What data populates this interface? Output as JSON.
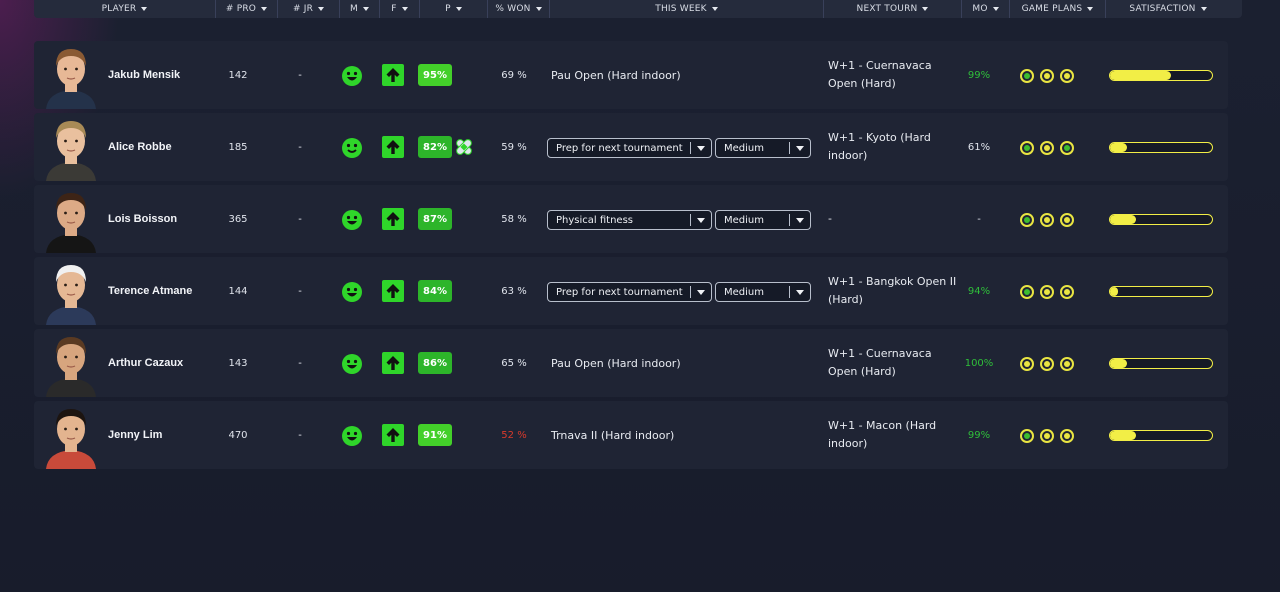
{
  "header": {
    "columns": [
      {
        "label": "PLAYER",
        "width": 182
      },
      {
        "label": "# PRO",
        "width": 62
      },
      {
        "label": "# JR",
        "width": 62
      },
      {
        "label": "M",
        "width": 40
      },
      {
        "label": "F",
        "width": 40
      },
      {
        "label": "P",
        "width": 68
      },
      {
        "label": "% WON",
        "width": 62
      },
      {
        "label": "THIS WEEK",
        "width": 274
      },
      {
        "label": "NEXT TOURN",
        "width": 138
      },
      {
        "label": "MO",
        "width": 48
      },
      {
        "label": "GAME PLANS",
        "width": 96
      },
      {
        "label": "SATISFACTION",
        "width": 124
      }
    ]
  },
  "players": [
    {
      "name": "Jakub Mensik",
      "pro_rank": "142",
      "jr_rank": "-",
      "mood": "happy",
      "form": "up",
      "physical": "95%",
      "physical_light": true,
      "injured": false,
      "won": "69 %",
      "won_bad": false,
      "this_week": {
        "type": "text",
        "text": "Pau Open (Hard indoor)"
      },
      "next_tourn": "W+1 - Cuernavaca Open (Hard)",
      "mo": "99%",
      "mo_green": true,
      "game_plans": [
        "green",
        "yellow",
        "yellow"
      ],
      "satisfaction": 0.6,
      "avatar": {
        "skin": "#e7b896",
        "hair": "#8a5a33",
        "shirt": "#24324a"
      }
    },
    {
      "name": "Alice Robbe",
      "pro_rank": "185",
      "jr_rank": "-",
      "mood": "content",
      "form": "up",
      "physical": "82%",
      "physical_light": false,
      "injured": true,
      "won": "59 %",
      "won_bad": false,
      "this_week": {
        "type": "dropdowns",
        "activity": "Prep for next tournament",
        "intensity": "Medium"
      },
      "next_tourn": "W+1 - Kyoto (Hard indoor)",
      "mo": "61%",
      "mo_green": false,
      "game_plans": [
        "green",
        "yellow",
        "green"
      ],
      "satisfaction": 0.17,
      "avatar": {
        "skin": "#e9c09e",
        "hair": "#a88a56",
        "shirt": "#3b3a36"
      }
    },
    {
      "name": "Lois Boisson",
      "pro_rank": "365",
      "jr_rank": "-",
      "mood": "happy",
      "form": "up",
      "physical": "87%",
      "physical_light": false,
      "injured": false,
      "won": "58 %",
      "won_bad": false,
      "this_week": {
        "type": "dropdowns",
        "activity": "Physical fitness",
        "intensity": "Medium"
      },
      "next_tourn": "-",
      "mo": "-",
      "mo_green": false,
      "game_plans": [
        "green",
        "yellow",
        "yellow"
      ],
      "satisfaction": 0.25,
      "avatar": {
        "skin": "#dcaa86",
        "hair": "#3d2416",
        "shirt": "#151515"
      }
    },
    {
      "name": "Terence Atmane",
      "pro_rank": "144",
      "jr_rank": "-",
      "mood": "happy",
      "form": "up",
      "physical": "84%",
      "physical_light": false,
      "injured": false,
      "won": "63 %",
      "won_bad": false,
      "this_week": {
        "type": "dropdowns",
        "activity": "Prep for next tournament",
        "intensity": "Medium"
      },
      "next_tourn": "W+1 - Bangkok Open II (Hard)",
      "mo": "94%",
      "mo_green": true,
      "game_plans": [
        "green",
        "yellow",
        "yellow"
      ],
      "satisfaction": 0.08,
      "avatar": {
        "skin": "#e5b894",
        "hair": "#f0f0f0",
        "shirt": "#2c3a5a"
      }
    },
    {
      "name": "Arthur Cazaux",
      "pro_rank": "143",
      "jr_rank": "-",
      "mood": "happy",
      "form": "up",
      "physical": "86%",
      "physical_light": false,
      "injured": false,
      "won": "65 %",
      "won_bad": false,
      "this_week": {
        "type": "text",
        "text": "Pau Open (Hard indoor)"
      },
      "next_tourn": "W+1 - Cuernavaca Open (Hard)",
      "mo": "100%",
      "mo_green": true,
      "game_plans": [
        "yellow",
        "yellow",
        "yellow"
      ],
      "satisfaction": 0.17,
      "avatar": {
        "skin": "#d7a57e",
        "hair": "#5a3a22",
        "shirt": "#2a2a2a"
      }
    },
    {
      "name": "Jenny Lim",
      "pro_rank": "470",
      "jr_rank": "-",
      "mood": "happy",
      "form": "up",
      "physical": "91%",
      "physical_light": true,
      "injured": false,
      "won": "52 %",
      "won_bad": true,
      "this_week": {
        "type": "text",
        "text": "Trnava II (Hard indoor)"
      },
      "next_tourn": "W+1 - Macon (Hard indoor)",
      "mo": "99%",
      "mo_green": true,
      "game_plans": [
        "green",
        "yellow",
        "yellow"
      ],
      "satisfaction": 0.25,
      "avatar": {
        "skin": "#e3b48f",
        "hair": "#1c1410",
        "shirt": "#c84a3a"
      }
    }
  ]
}
